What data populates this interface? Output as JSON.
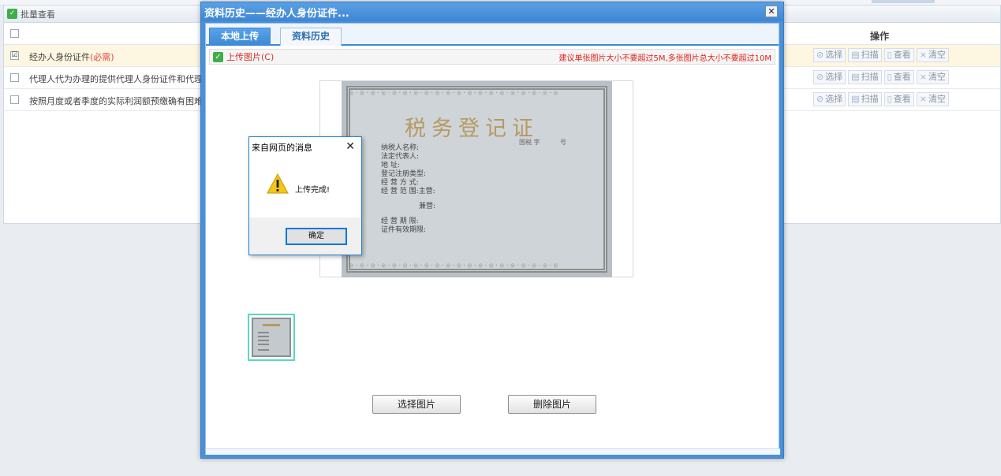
{
  "background": {
    "panel_title": "批量查看",
    "operations_header": "操作",
    "rows": [
      {
        "label": "经办人身份证件",
        "required": "(必需)",
        "checked": "☑"
      },
      {
        "label": "代理人代为办理的提供代理人身份证件和代理委",
        "required": "",
        "checked": ""
      },
      {
        "label": "按照月度或者季度的实际利润额预缴确有困难的",
        "required": "",
        "checked": ""
      }
    ],
    "op_buttons": {
      "select": "选择",
      "scan": "扫描",
      "view": "查看",
      "clear": "清空"
    }
  },
  "dialog": {
    "title": "资料历史——经办人身份证件...",
    "close_symbol": "✕",
    "tabs": [
      {
        "label": "本地上传",
        "active": true
      },
      {
        "label": "资料历史",
        "active": false
      }
    ],
    "upload_label": "上传图片(C)",
    "upload_hint": "建议单张图片大小不要超过5M,多张图片总大小不要超过10M",
    "certificate": {
      "title": "税务登记证",
      "number_prefix": "国税  字",
      "number_suffix": "号",
      "fields": [
        "纳税人名称:",
        "法定代表人:",
        "地    址:",
        "登记注册类型:",
        "经 营 方 式:",
        "经 营 范 围:主营:",
        "兼营:",
        "经 营 期 限:",
        "证件有效期限:"
      ]
    },
    "buttons": {
      "choose": "选择图片",
      "delete": "删除图片"
    }
  },
  "message_box": {
    "title": "来自网页的消息",
    "close_symbol": "✕",
    "text": "上传完成!",
    "ok_label": "确定"
  },
  "colors": {
    "dialog_blue": "#4a90d9",
    "tab_active": "#3c88d4",
    "hint_red": "#e0201a",
    "required_red": "#e0483e",
    "thumb_border": "#57d8c3",
    "warning_yellow": "#f5c518"
  }
}
